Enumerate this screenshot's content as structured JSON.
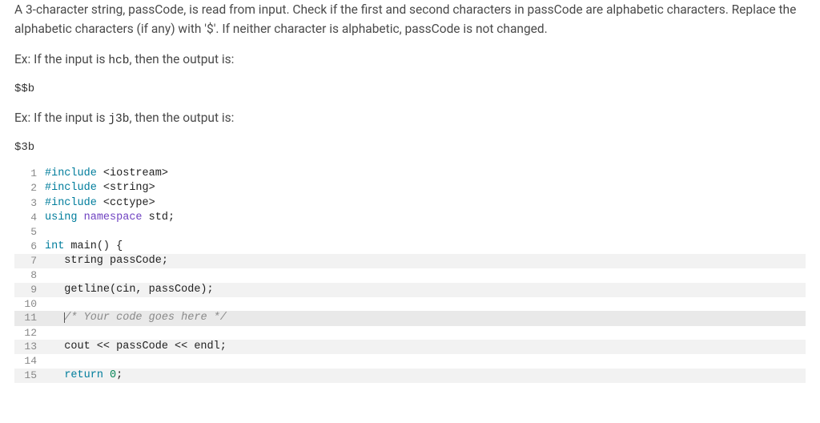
{
  "problem": {
    "p1": "A 3-character string, passCode, is read from input. Check if the first and second characters in passCode are alphabetic characters. Replace the alphabetic characters (if any) with '$'. If neither character is alphabetic, passCode is not changed.",
    "ex1_prefix": "Ex: If the input is ",
    "ex1_code": "hcb",
    "ex1_suffix": ", then the output is:",
    "out1": "$$b",
    "ex2_prefix": "Ex: If the input is ",
    "ex2_code": "j3b",
    "ex2_suffix": ", then the output is:",
    "out2": "$3b"
  },
  "code": {
    "lines": [
      {
        "n": 1,
        "hl": false,
        "tokens": [
          {
            "c": "pre",
            "t": "#include"
          },
          {
            "c": "spn",
            "t": " <iostream>"
          }
        ]
      },
      {
        "n": 2,
        "hl": false,
        "tokens": [
          {
            "c": "pre",
            "t": "#include"
          },
          {
            "c": "spn",
            "t": " <string>"
          }
        ]
      },
      {
        "n": 3,
        "hl": false,
        "tokens": [
          {
            "c": "pre",
            "t": "#include"
          },
          {
            "c": "spn",
            "t": " <cctype>"
          }
        ]
      },
      {
        "n": 4,
        "hl": false,
        "tokens": [
          {
            "c": "kw",
            "t": "using"
          },
          {
            "c": "spn",
            "t": " "
          },
          {
            "c": "ns",
            "t": "namespace"
          },
          {
            "c": "spn",
            "t": " std;"
          }
        ]
      },
      {
        "n": 5,
        "hl": false,
        "tokens": [
          {
            "c": "spn",
            "t": ""
          }
        ]
      },
      {
        "n": 6,
        "hl": false,
        "tokens": [
          {
            "c": "kw",
            "t": "int"
          },
          {
            "c": "spn",
            "t": " main() {"
          }
        ]
      },
      {
        "n": 7,
        "hl": true,
        "tokens": [
          {
            "c": "spn",
            "t": "   string passCode;"
          }
        ]
      },
      {
        "n": 8,
        "hl": false,
        "tokens": [
          {
            "c": "spn",
            "t": ""
          }
        ]
      },
      {
        "n": 9,
        "hl": true,
        "tokens": [
          {
            "c": "spn",
            "t": "   getline(cin, passCode);"
          }
        ]
      },
      {
        "n": 10,
        "hl": false,
        "tokens": [
          {
            "c": "spn",
            "t": ""
          }
        ]
      },
      {
        "n": 11,
        "hl": "active",
        "tokens": [
          {
            "c": "spn",
            "t": "   "
          },
          {
            "c": "cmt",
            "t": "/* Your code goes here */",
            "cursor": true
          }
        ]
      },
      {
        "n": 12,
        "hl": false,
        "tokens": [
          {
            "c": "spn",
            "t": ""
          }
        ]
      },
      {
        "n": 13,
        "hl": true,
        "tokens": [
          {
            "c": "spn",
            "t": "   cout << passCode << endl;"
          }
        ]
      },
      {
        "n": 14,
        "hl": false,
        "tokens": [
          {
            "c": "spn",
            "t": ""
          }
        ]
      },
      {
        "n": 15,
        "hl": true,
        "tokens": [
          {
            "c": "spn",
            "t": "   "
          },
          {
            "c": "kw",
            "t": "return"
          },
          {
            "c": "spn",
            "t": " "
          },
          {
            "c": "num",
            "t": "0"
          },
          {
            "c": "spn",
            "t": ";"
          }
        ]
      }
    ]
  }
}
